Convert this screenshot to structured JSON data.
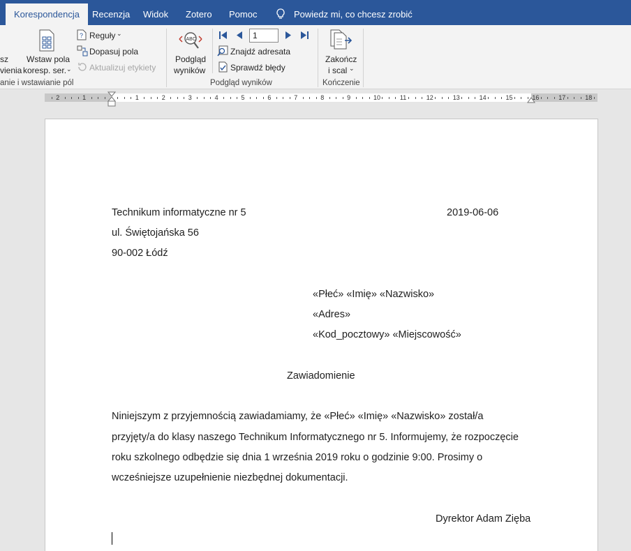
{
  "tabs": [
    {
      "label": "Korespondencja",
      "active": true
    },
    {
      "label": "Recenzja",
      "active": false
    },
    {
      "label": "Widok",
      "active": false
    },
    {
      "label": "Zotero",
      "active": false
    },
    {
      "label": "Pomoc",
      "active": false
    }
  ],
  "tell_me": "Powiedz mi, co chcesz zrobić",
  "ribbon": {
    "group_insert": {
      "cut_btn_line1": "sz",
      "cut_btn_line2": "vienia",
      "insert_field_line1": "Wstaw pola",
      "insert_field_line2": "koresp. ser.",
      "rules": "Reguły",
      "match_fields": "Dopasuj pola",
      "update_labels": "Aktualizuj etykiety",
      "label": "anie i wstawianie pól"
    },
    "group_preview": {
      "preview_line1": "Podgląd",
      "preview_line2": "wyników",
      "record_number": "1",
      "find_recipient": "Znajdź adresata",
      "check_errors": "Sprawdź błędy",
      "label": "Podgląd wyników"
    },
    "group_finish": {
      "finish_line1": "Zakończ",
      "finish_line2": "i scal",
      "label": "Kończenie"
    }
  },
  "ruler": {
    "left_numbers": [
      "2",
      "1"
    ],
    "right_numbers": [
      "1",
      "2",
      "3",
      "4",
      "5",
      "6",
      "7",
      "8",
      "9",
      "10",
      "11",
      "12",
      "13",
      "14",
      "15",
      "16",
      "17",
      "18"
    ]
  },
  "document": {
    "sender_name": " Technikum informatyczne nr 5",
    "date": "2019-06-06",
    "sender_street": "ul. Świętojańska 56",
    "sender_city": "90-002 Łódź",
    "recipient_line1": "«Płeć» «Imię» «Nazwisko»",
    "recipient_line2": "«Adres»",
    "recipient_line3": "«Kod_pocztowy» «Miejscowość»",
    "title": "Zawiadomienie",
    "body_lines": [
      "Niniejszym z przyjemnością zawiadamiamy, że  «Płeć» «Imię» «Nazwisko» został/a",
      "przyjęty/a do klasy naszego Technikum Informatycznego nr 5. Informujemy, że rozpoczęcie",
      "roku szkolnego odbędzie się dnia 1 września 2019 roku o godzinie 9:00. Prosimy o",
      "wcześniejsze uzupełnienie niezbędnej dokumentacji."
    ],
    "signature": "Dyrektor Adam Zięba"
  }
}
